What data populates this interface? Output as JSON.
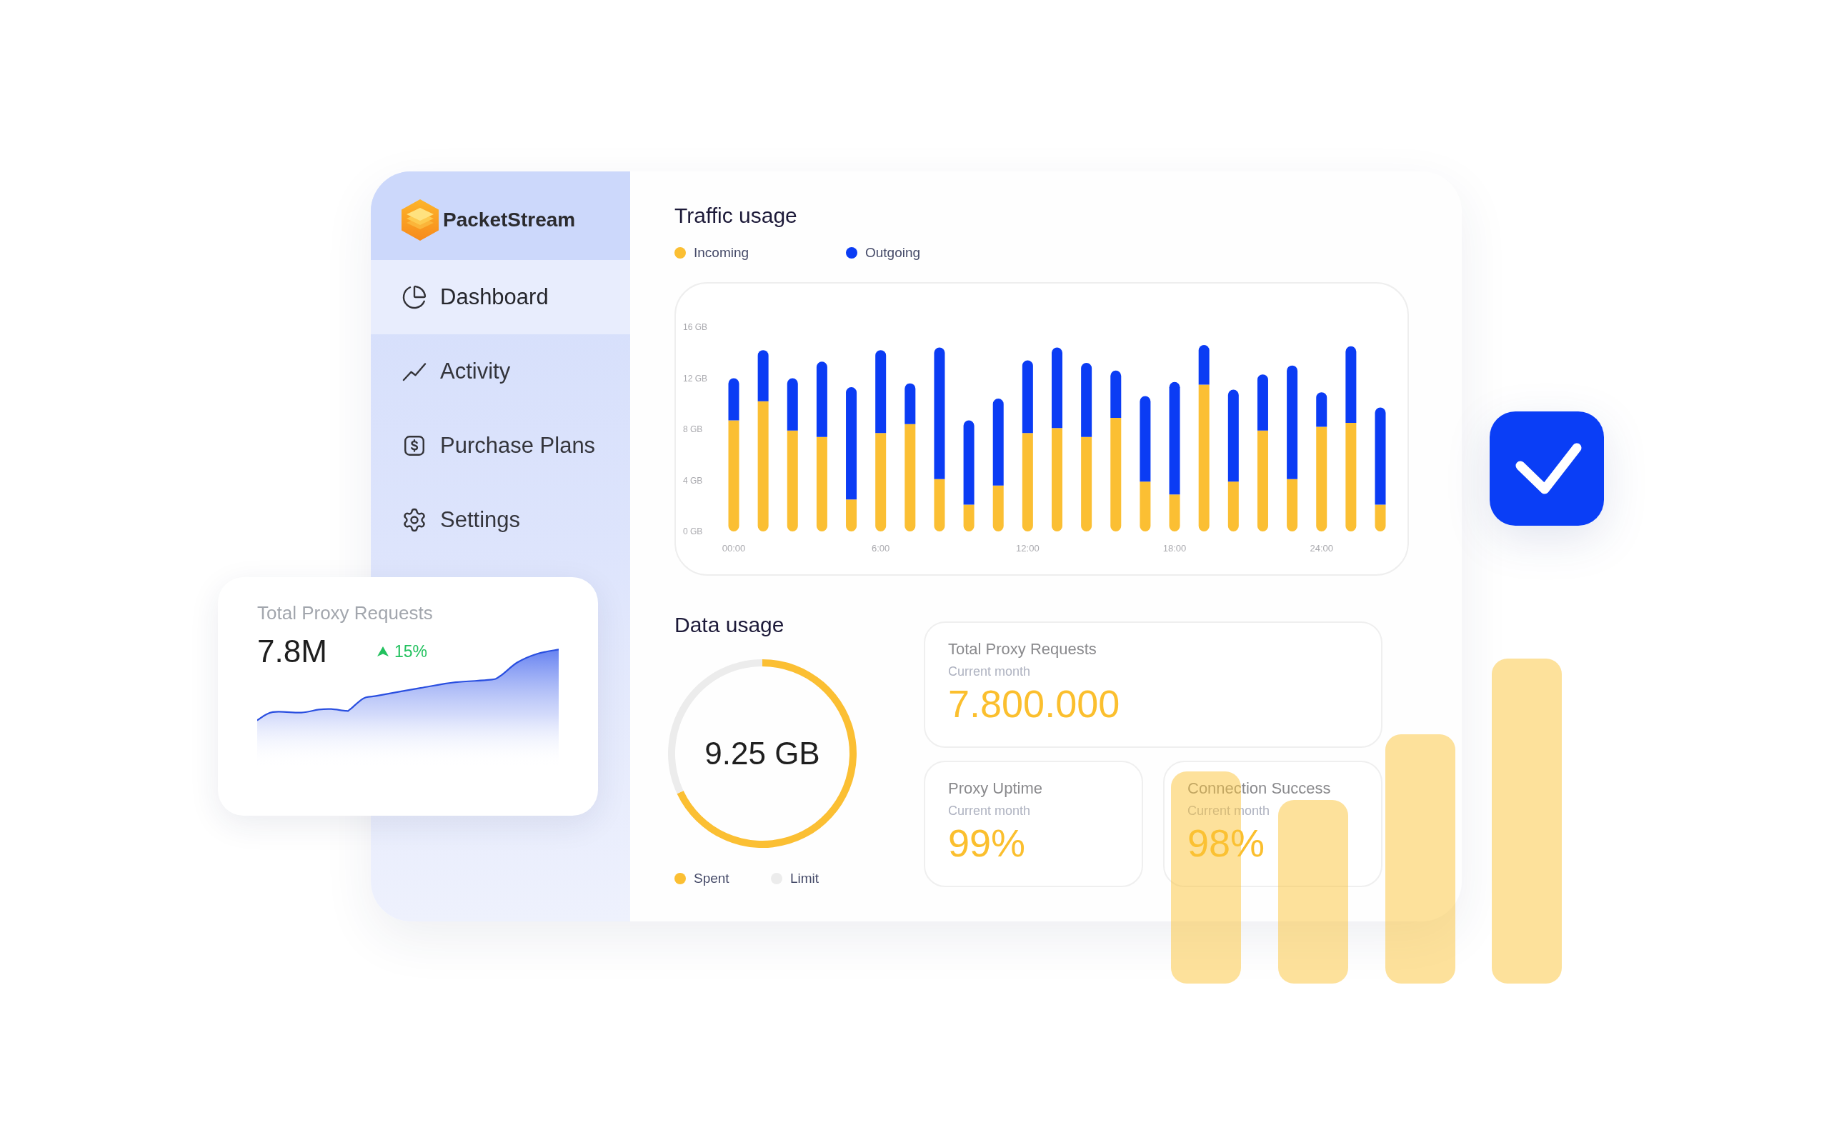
{
  "brand": {
    "name": "PacketStream"
  },
  "sidebar": {
    "items": [
      {
        "label": "Dashboard",
        "selected": true
      },
      {
        "label": "Activity",
        "selected": false
      },
      {
        "label": "Purchase Plans",
        "selected": false
      },
      {
        "label": "Settings",
        "selected": false
      }
    ]
  },
  "traffic_usage": {
    "title": "Traffic usage",
    "chart_data": {
      "type": "bar",
      "stacked": true,
      "categories": [
        "00:00",
        null,
        null,
        null,
        null,
        "6:00",
        null,
        null,
        null,
        null,
        "12:00",
        null,
        null,
        null,
        null,
        "18:00",
        null,
        null,
        null,
        null,
        "24:00",
        null,
        null
      ],
      "ylim": [
        0,
        16
      ],
      "yticks": [
        {
          "value": 0,
          "label": "0 GB"
        },
        {
          "value": 4,
          "label": "4 GB"
        },
        {
          "value": 8,
          "label": "8 GB"
        },
        {
          "value": 12,
          "label": "12 GB"
        },
        {
          "value": 16,
          "label": "16 GB"
        }
      ],
      "series": [
        {
          "name": "Incoming",
          "color": "#fbbf33",
          "values": [
            8.7,
            10.2,
            7.9,
            7.4,
            2.5,
            7.7,
            8.4,
            4.1,
            2.1,
            3.6,
            7.7,
            8.1,
            7.4,
            8.9,
            3.9,
            2.9,
            11.5,
            3.9,
            7.9,
            4.1,
            8.2,
            8.5,
            2.1
          ]
        },
        {
          "name": "Outgoing",
          "color": "#0b3cf4",
          "values": [
            3.3,
            4.0,
            4.1,
            5.9,
            8.8,
            6.5,
            3.2,
            10.3,
            6.6,
            6.8,
            5.7,
            6.3,
            5.8,
            3.7,
            6.7,
            8.8,
            3.1,
            7.2,
            4.4,
            8.9,
            2.7,
            6.0,
            7.6
          ]
        }
      ]
    }
  },
  "data_usage": {
    "title": "Data usage",
    "total": "9.25 GB",
    "chart_data": {
      "type": "donut",
      "categories": [
        "Spent",
        "Limit"
      ],
      "values": [
        68,
        32
      ],
      "colors": [
        "#fbbf33",
        "#ececec"
      ]
    }
  },
  "stats": [
    {
      "title": "Total Proxy Requests",
      "subtitle": "Current month",
      "value": "7.800.000"
    },
    {
      "title": "Proxy Uptime",
      "subtitle": "Current month",
      "value": "99%"
    },
    {
      "title": "Connection Success",
      "subtitle": "Current month",
      "value": "98%"
    }
  ],
  "summary_card": {
    "title": "Total Proxy Requests",
    "value": "7.8M",
    "change": "15%",
    "increase": true
  }
}
